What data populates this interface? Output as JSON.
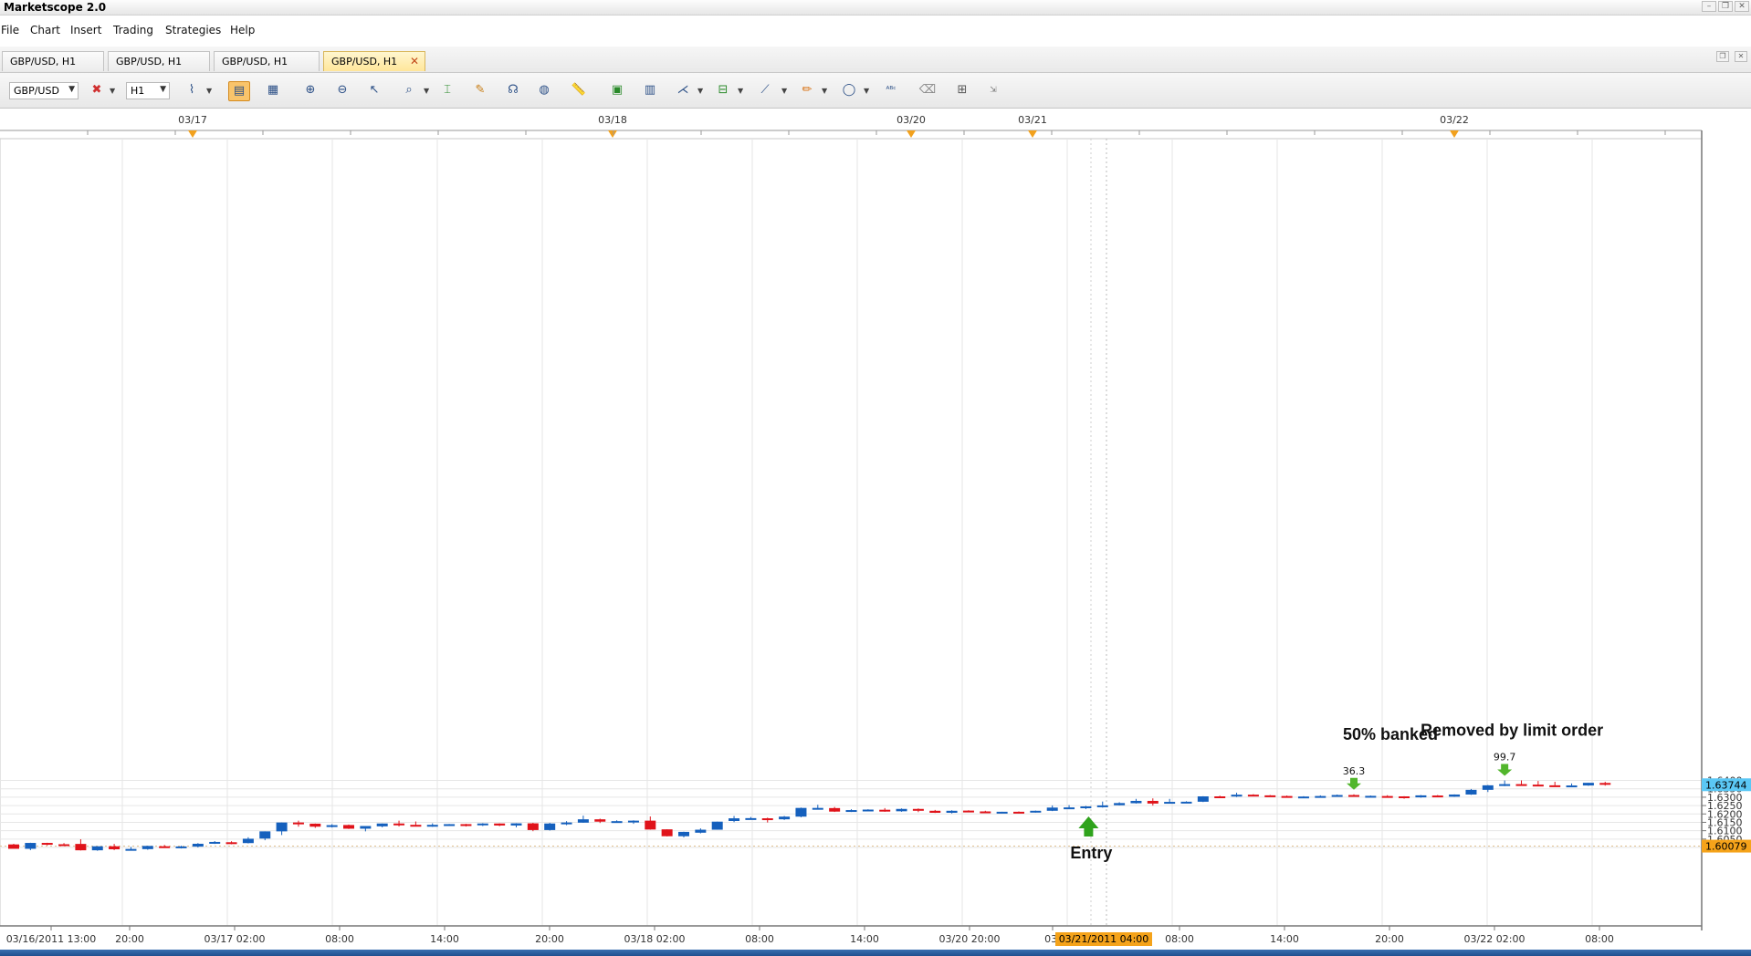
{
  "app": {
    "title": "Marketscope 2.0"
  },
  "menu": [
    "File",
    "Chart",
    "Insert",
    "Trading",
    "Strategies",
    "Help"
  ],
  "tabs": [
    {
      "label": "GBP/USD, H1",
      "active": false
    },
    {
      "label": "GBP/USD, H1",
      "active": false
    },
    {
      "label": "GBP/USD, H1",
      "active": false
    },
    {
      "label": "GBP/USD, H1",
      "active": true,
      "close": "✕"
    }
  ],
  "toolbar": {
    "symbol": "GBP/USD",
    "timeframe": "H1",
    "icons": [
      "chart-type-icon",
      "data-window-icon",
      "time-marker-icon",
      "zoom-in-icon",
      "zoom-out-icon",
      "cursor-icon",
      "zoom-area-icon",
      "indicator-icon",
      "add-indicator-icon",
      "signal-icon",
      "globe-icon",
      "ruler-icon",
      "picture-icon",
      "layout-icon",
      "fibonacci-icon",
      "level-icon",
      "line-tool-icon",
      "pencil-icon",
      "ellipse-icon",
      "text-icon",
      "eraser-icon",
      "grid-icon",
      "more-icon"
    ]
  },
  "top_dates": [
    "03/17",
    "03/18",
    "03/20",
    "03/21",
    "03/22"
  ],
  "chart_data": {
    "type": "candlestick",
    "symbol": "GBP/USD",
    "timeframe": "H1",
    "y_axis": {
      "ticks": [
        "1.6000",
        "1.6050",
        "1.6100",
        "1.6150",
        "1.6200",
        "1.6250",
        "1.6300",
        "1.6350",
        "1.6400"
      ],
      "range": [
        1.5955,
        1.6435
      ]
    },
    "x_axis": {
      "labels": [
        "03/16/2011 13:00",
        "20:00",
        "03/17 02:00",
        "08:00",
        "14:00",
        "20:00",
        "03/18 02:00",
        "08:00",
        "14:00",
        "03/20 20:00",
        "03/",
        "08:00",
        "14:00",
        "20:00",
        "03/22 02:00",
        "08:00"
      ],
      "cursor_label": "03/21/2011 04:00"
    },
    "current_price": {
      "label": "1.63744",
      "value": 1.63744,
      "color": "#5bc8f5"
    },
    "marker_price": {
      "label": "1.60079",
      "value": 1.60079,
      "color": "#f5a31a"
    },
    "colors": {
      "up": "#1560bd",
      "down": "#e0131a",
      "arrow": "#2fa31c"
    },
    "candles": [
      {
        "o": 1.6018,
        "h": 1.6022,
        "l": 1.5993,
        "c": 1.5992
      },
      {
        "o": 1.5992,
        "h": 1.6028,
        "l": 1.5984,
        "c": 1.6027
      },
      {
        "o": 1.6027,
        "h": 1.6028,
        "l": 1.6012,
        "c": 1.6021
      },
      {
        "o": 1.6019,
        "h": 1.6026,
        "l": 1.6009,
        "c": 1.6018
      },
      {
        "o": 1.6021,
        "h": 1.6049,
        "l": 1.5982,
        "c": 1.5983
      },
      {
        "o": 1.5983,
        "h": 1.6007,
        "l": 1.598,
        "c": 1.6007
      },
      {
        "o": 1.6007,
        "h": 1.6021,
        "l": 1.5984,
        "c": 1.5989
      },
      {
        "o": 1.5989,
        "h": 1.6003,
        "l": 1.5985,
        "c": 1.5991
      },
      {
        "o": 1.599,
        "h": 1.601,
        "l": 1.5986,
        "c": 1.6009
      },
      {
        "o": 1.6007,
        "h": 1.6015,
        "l": 1.5997,
        "c": 1.6002
      },
      {
        "o": 1.6002,
        "h": 1.601,
        "l": 1.5994,
        "c": 1.6006
      },
      {
        "o": 1.6005,
        "h": 1.6026,
        "l": 1.6,
        "c": 1.6022
      },
      {
        "o": 1.6023,
        "h": 1.6038,
        "l": 1.6021,
        "c": 1.6033
      },
      {
        "o": 1.6031,
        "h": 1.6037,
        "l": 1.6019,
        "c": 1.6026
      },
      {
        "o": 1.6026,
        "h": 1.6061,
        "l": 1.6024,
        "c": 1.6052
      },
      {
        "o": 1.6053,
        "h": 1.6096,
        "l": 1.6043,
        "c": 1.6096
      },
      {
        "o": 1.6096,
        "h": 1.6149,
        "l": 1.6074,
        "c": 1.6149
      },
      {
        "o": 1.6149,
        "h": 1.616,
        "l": 1.6124,
        "c": 1.6142
      },
      {
        "o": 1.6142,
        "h": 1.6143,
        "l": 1.6117,
        "c": 1.6124
      },
      {
        "o": 1.6124,
        "h": 1.6139,
        "l": 1.6119,
        "c": 1.6133
      },
      {
        "o": 1.6134,
        "h": 1.6137,
        "l": 1.611,
        "c": 1.6112
      },
      {
        "o": 1.6112,
        "h": 1.6127,
        "l": 1.6096,
        "c": 1.6128
      },
      {
        "o": 1.6126,
        "h": 1.6143,
        "l": 1.612,
        "c": 1.6143
      },
      {
        "o": 1.6143,
        "h": 1.616,
        "l": 1.6125,
        "c": 1.6135
      },
      {
        "o": 1.6135,
        "h": 1.6155,
        "l": 1.6125,
        "c": 1.6129
      },
      {
        "o": 1.6128,
        "h": 1.6144,
        "l": 1.6123,
        "c": 1.6135
      },
      {
        "o": 1.6136,
        "h": 1.614,
        "l": 1.6128,
        "c": 1.6139
      },
      {
        "o": 1.6139,
        "h": 1.6141,
        "l": 1.6125,
        "c": 1.6134
      },
      {
        "o": 1.6133,
        "h": 1.6145,
        "l": 1.6128,
        "c": 1.6143
      },
      {
        "o": 1.6143,
        "h": 1.6144,
        "l": 1.6127,
        "c": 1.6131
      },
      {
        "o": 1.6131,
        "h": 1.6145,
        "l": 1.612,
        "c": 1.6144
      },
      {
        "o": 1.6144,
        "h": 1.6147,
        "l": 1.6097,
        "c": 1.6104
      },
      {
        "o": 1.6104,
        "h": 1.6147,
        "l": 1.6101,
        "c": 1.6143
      },
      {
        "o": 1.6141,
        "h": 1.6157,
        "l": 1.6133,
        "c": 1.6149
      },
      {
        "o": 1.6148,
        "h": 1.619,
        "l": 1.6147,
        "c": 1.6168
      },
      {
        "o": 1.6168,
        "h": 1.6172,
        "l": 1.6146,
        "c": 1.6154
      },
      {
        "o": 1.6157,
        "h": 1.6162,
        "l": 1.615,
        "c": 1.6157
      },
      {
        "o": 1.6157,
        "h": 1.6162,
        "l": 1.6141,
        "c": 1.616
      },
      {
        "o": 1.616,
        "h": 1.6185,
        "l": 1.6106,
        "c": 1.6107
      },
      {
        "o": 1.6108,
        "h": 1.6108,
        "l": 1.6066,
        "c": 1.6067
      },
      {
        "o": 1.6067,
        "h": 1.6094,
        "l": 1.606,
        "c": 1.6093
      },
      {
        "o": 1.6088,
        "h": 1.6114,
        "l": 1.6084,
        "c": 1.6106
      },
      {
        "o": 1.6106,
        "h": 1.6154,
        "l": 1.6106,
        "c": 1.6154
      },
      {
        "o": 1.6158,
        "h": 1.6188,
        "l": 1.6151,
        "c": 1.6174
      },
      {
        "o": 1.6174,
        "h": 1.6182,
        "l": 1.6168,
        "c": 1.6175
      },
      {
        "o": 1.6174,
        "h": 1.6178,
        "l": 1.6149,
        "c": 1.6168
      },
      {
        "o": 1.6168,
        "h": 1.6188,
        "l": 1.6164,
        "c": 1.6184
      },
      {
        "o": 1.6184,
        "h": 1.6238,
        "l": 1.618,
        "c": 1.6236
      },
      {
        "o": 1.6236,
        "h": 1.6255,
        "l": 1.6232,
        "c": 1.6236
      },
      {
        "o": 1.6235,
        "h": 1.6242,
        "l": 1.6212,
        "c": 1.6214
      },
      {
        "o": 1.6213,
        "h": 1.6228,
        "l": 1.6212,
        "c": 1.6223
      },
      {
        "o": 1.6222,
        "h": 1.6228,
        "l": 1.622,
        "c": 1.6226
      },
      {
        "o": 1.6225,
        "h": 1.6235,
        "l": 1.6213,
        "c": 1.6216
      },
      {
        "o": 1.6216,
        "h": 1.6233,
        "l": 1.6213,
        "c": 1.623
      },
      {
        "o": 1.623,
        "h": 1.6233,
        "l": 1.6211,
        "c": 1.6219
      },
      {
        "o": 1.6219,
        "h": 1.6224,
        "l": 1.6206,
        "c": 1.6207
      },
      {
        "o": 1.6207,
        "h": 1.6222,
        "l": 1.6203,
        "c": 1.6219
      },
      {
        "o": 1.622,
        "h": 1.6222,
        "l": 1.6212,
        "c": 1.6215
      },
      {
        "o": 1.6215,
        "h": 1.6219,
        "l": 1.6208,
        "c": 1.6208
      },
      {
        "o": 1.6209,
        "h": 1.6213,
        "l": 1.6204,
        "c": 1.6213
      },
      {
        "o": 1.6213,
        "h": 1.6215,
        "l": 1.6208,
        "c": 1.621
      },
      {
        "o": 1.621,
        "h": 1.622,
        "l": 1.6208,
        "c": 1.6219
      },
      {
        "o": 1.6219,
        "h": 1.6251,
        "l": 1.6217,
        "c": 1.6238
      },
      {
        "o": 1.6239,
        "h": 1.6253,
        "l": 1.6233,
        "c": 1.6239
      },
      {
        "o": 1.6239,
        "h": 1.6248,
        "l": 1.6229,
        "c": 1.6245
      },
      {
        "o": 1.6244,
        "h": 1.6274,
        "l": 1.6238,
        "c": 1.6251
      },
      {
        "o": 1.6252,
        "h": 1.627,
        "l": 1.6251,
        "c": 1.6265
      },
      {
        "o": 1.6264,
        "h": 1.629,
        "l": 1.6262,
        "c": 1.6278
      },
      {
        "o": 1.6278,
        "h": 1.6293,
        "l": 1.625,
        "c": 1.6262
      },
      {
        "o": 1.6262,
        "h": 1.629,
        "l": 1.6262,
        "c": 1.6272
      },
      {
        "o": 1.6271,
        "h": 1.6276,
        "l": 1.6264,
        "c": 1.6273
      },
      {
        "o": 1.6273,
        "h": 1.6306,
        "l": 1.6271,
        "c": 1.6305
      },
      {
        "o": 1.6305,
        "h": 1.6309,
        "l": 1.6298,
        "c": 1.6303
      },
      {
        "o": 1.6304,
        "h": 1.6327,
        "l": 1.6301,
        "c": 1.6315
      },
      {
        "o": 1.6315,
        "h": 1.6318,
        "l": 1.6308,
        "c": 1.6311
      },
      {
        "o": 1.6311,
        "h": 1.6313,
        "l": 1.6304,
        "c": 1.6308
      },
      {
        "o": 1.6307,
        "h": 1.631,
        "l": 1.6298,
        "c": 1.6301
      },
      {
        "o": 1.6301,
        "h": 1.6306,
        "l": 1.6298,
        "c": 1.6304
      },
      {
        "o": 1.6303,
        "h": 1.6311,
        "l": 1.6302,
        "c": 1.6307
      },
      {
        "o": 1.6308,
        "h": 1.6316,
        "l": 1.6306,
        "c": 1.6313
      },
      {
        "o": 1.6313,
        "h": 1.6317,
        "l": 1.6303,
        "c": 1.6305
      },
      {
        "o": 1.6305,
        "h": 1.631,
        "l": 1.6303,
        "c": 1.6308
      },
      {
        "o": 1.6307,
        "h": 1.6312,
        "l": 1.6302,
        "c": 1.6304
      },
      {
        "o": 1.6305,
        "h": 1.6306,
        "l": 1.6291,
        "c": 1.6299
      },
      {
        "o": 1.6299,
        "h": 1.6313,
        "l": 1.6297,
        "c": 1.6311
      },
      {
        "o": 1.631,
        "h": 1.6313,
        "l": 1.6301,
        "c": 1.6303
      },
      {
        "o": 1.6303,
        "h": 1.6317,
        "l": 1.6302,
        "c": 1.6316
      },
      {
        "o": 1.6316,
        "h": 1.6349,
        "l": 1.6314,
        "c": 1.6344
      },
      {
        "o": 1.6344,
        "h": 1.6373,
        "l": 1.6331,
        "c": 1.6371
      },
      {
        "o": 1.6371,
        "h": 1.64,
        "l": 1.6366,
        "c": 1.6378
      },
      {
        "o": 1.6378,
        "h": 1.64,
        "l": 1.6372,
        "c": 1.6375
      },
      {
        "o": 1.6375,
        "h": 1.6397,
        "l": 1.6369,
        "c": 1.637
      },
      {
        "o": 1.6371,
        "h": 1.6392,
        "l": 1.6366,
        "c": 1.6366
      },
      {
        "o": 1.6366,
        "h": 1.6382,
        "l": 1.6364,
        "c": 1.637
      },
      {
        "o": 1.637,
        "h": 1.6386,
        "l": 1.6368,
        "c": 1.6386
      },
      {
        "o": 1.6385,
        "h": 1.6392,
        "l": 1.6369,
        "c": 1.6374
      }
    ],
    "annotations": [
      {
        "text": "Entry",
        "candle": 64,
        "kind": "arrow-up-big"
      },
      {
        "text": "50% banked",
        "candle": 80,
        "kind": "label"
      },
      {
        "text": "36.3",
        "candle": 80,
        "kind": "arrow-down-small"
      },
      {
        "text": "Removed by limit order",
        "candle": 89,
        "kind": "label"
      },
      {
        "text": "99.7",
        "candle": 89,
        "kind": "arrow-down-small"
      }
    ]
  }
}
